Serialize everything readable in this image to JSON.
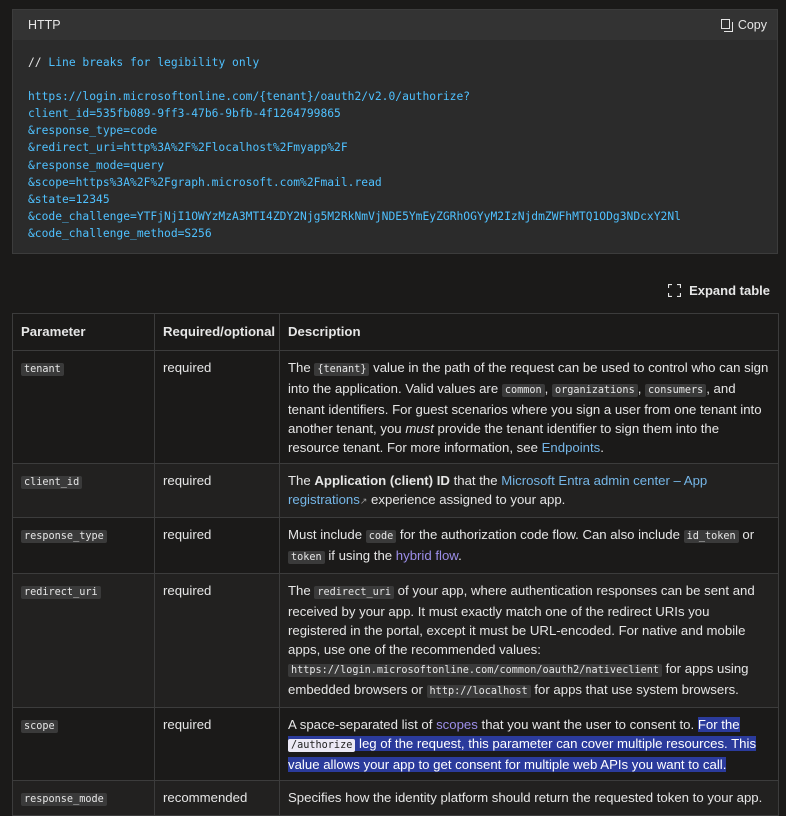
{
  "code_block": {
    "language": "HTTP",
    "copy_label": "Copy",
    "comment_slashes": "//",
    "comment_text": " Line breaks for legibility only",
    "lines": [
      "https://login.microsoftonline.com/{tenant}/oauth2/v2.0/authorize?",
      "client_id=535fb089-9ff3-47b6-9bfb-4f1264799865",
      "&response_type=code",
      "&redirect_uri=http%3A%2F%2Flocalhost%2Fmyapp%2F",
      "&response_mode=query",
      "&scope=https%3A%2F%2Fgraph.microsoft.com%2Fmail.read",
      "&state=12345",
      "&code_challenge=YTFjNjI1OWYzMzA3MTI4ZDY2Njg5M2RkNmVjNDE5YmEyZGRhOGYyM2IzNjdmZWFhMTQ1ODg3NDcxY2Nl",
      "&code_challenge_method=S256"
    ]
  },
  "expand_label": "Expand table",
  "table": {
    "headers": [
      "Parameter",
      "Required/optional",
      "Description"
    ],
    "rows": {
      "tenant": {
        "param": "tenant",
        "req": "required",
        "d1": "The ",
        "c1": "{tenant}",
        "d2": " value in the path of the request can be used to control who can sign into the application. Valid values are ",
        "c2": "common",
        "d3": ", ",
        "c3": "organizations",
        "d4": ", ",
        "c4": "consumers",
        "d5": ", and tenant identifiers. For guest scenarios where you sign a user from one tenant into another tenant, you ",
        "em": "must",
        "d6": " provide the tenant identifier to sign them into the resource tenant. For more information, see ",
        "link": "Endpoints",
        "d7": "."
      },
      "client_id": {
        "param": "client_id",
        "req": "required",
        "d1": "The ",
        "b1": "Application (client) ID",
        "d2": " that the ",
        "link": "Microsoft Entra admin center – App registrations",
        "d3": " experience assigned to your app."
      },
      "response_type": {
        "param": "response_type",
        "req": "required",
        "d1": "Must include ",
        "c1": "code",
        "d2": " for the authorization code flow. Can also include ",
        "c2": "id_token",
        "d3": " or ",
        "c3": "token",
        "d4": " if using the ",
        "link": "hybrid flow",
        "d5": "."
      },
      "redirect_uri": {
        "param": "redirect_uri",
        "req": "required",
        "d1": "The ",
        "c1": "redirect_uri",
        "d2": " of your app, where authentication responses can be sent and received by your app. It must exactly match one of the redirect URIs you registered in the portal, except it must be URL-encoded. For native and mobile apps, use one of the recommended values: ",
        "c2": "https://login.microsoftonline.com/common/oauth2/nativeclient",
        "d3": " for apps using embedded browsers or ",
        "c3": "http://localhost",
        "d4": " for apps that use system browsers."
      },
      "scope": {
        "param": "scope",
        "req": "required",
        "d1": "A space-separated list of ",
        "link": "scopes",
        "d2": " that you want the user to consent to. ",
        "h1": "For the ",
        "hc": "/authorize",
        "h2": " leg of the request, this parameter can cover multiple resources. This value allows your app to get consent for multiple web APIs you want to call."
      },
      "response_mode": {
        "param": "response_mode",
        "req": "recommended",
        "d1": "Specifies how the identity platform should return the requested token to your app."
      }
    }
  }
}
